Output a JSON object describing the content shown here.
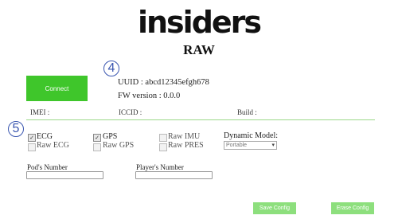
{
  "header": {
    "logo_text": "insiders",
    "title": "RAW"
  },
  "markers": {
    "device_info": "4",
    "options": "5"
  },
  "connect": {
    "label": "Connect"
  },
  "device": {
    "uuid_label": "UUID :",
    "uuid_value": "abcd12345efgh678",
    "fw_label": "FW version :",
    "fw_value": "0.0.0"
  },
  "ids": {
    "imei_label": "IMEI :",
    "iccid_label": "ICCID :",
    "build_label": "Build :"
  },
  "options": {
    "ecg": {
      "label": "ECG",
      "checked": true
    },
    "gps": {
      "label": "GPS",
      "checked": true
    },
    "raw_imu": {
      "label": "Raw IMU",
      "checked": false
    },
    "raw_ecg": {
      "label": "Raw ECG",
      "checked": false
    },
    "raw_gps": {
      "label": "Raw GPS",
      "checked": false
    },
    "raw_pres": {
      "label": "Raw PRES",
      "checked": false
    },
    "dynamic_model": {
      "label": "Dynamic Model:",
      "selected": "Portable"
    }
  },
  "fields": {
    "pod_number": {
      "label": "Pod's Number",
      "value": ""
    },
    "player_number": {
      "label": "Player's Number",
      "value": ""
    }
  },
  "actions": {
    "save_label": "Save Config",
    "erase_label": "Erase Config"
  },
  "colors": {
    "connect": "#3fc62b",
    "config_buttons": "#8ddf7d",
    "marker": "#3a56b0",
    "divider": "#9bd88a"
  }
}
